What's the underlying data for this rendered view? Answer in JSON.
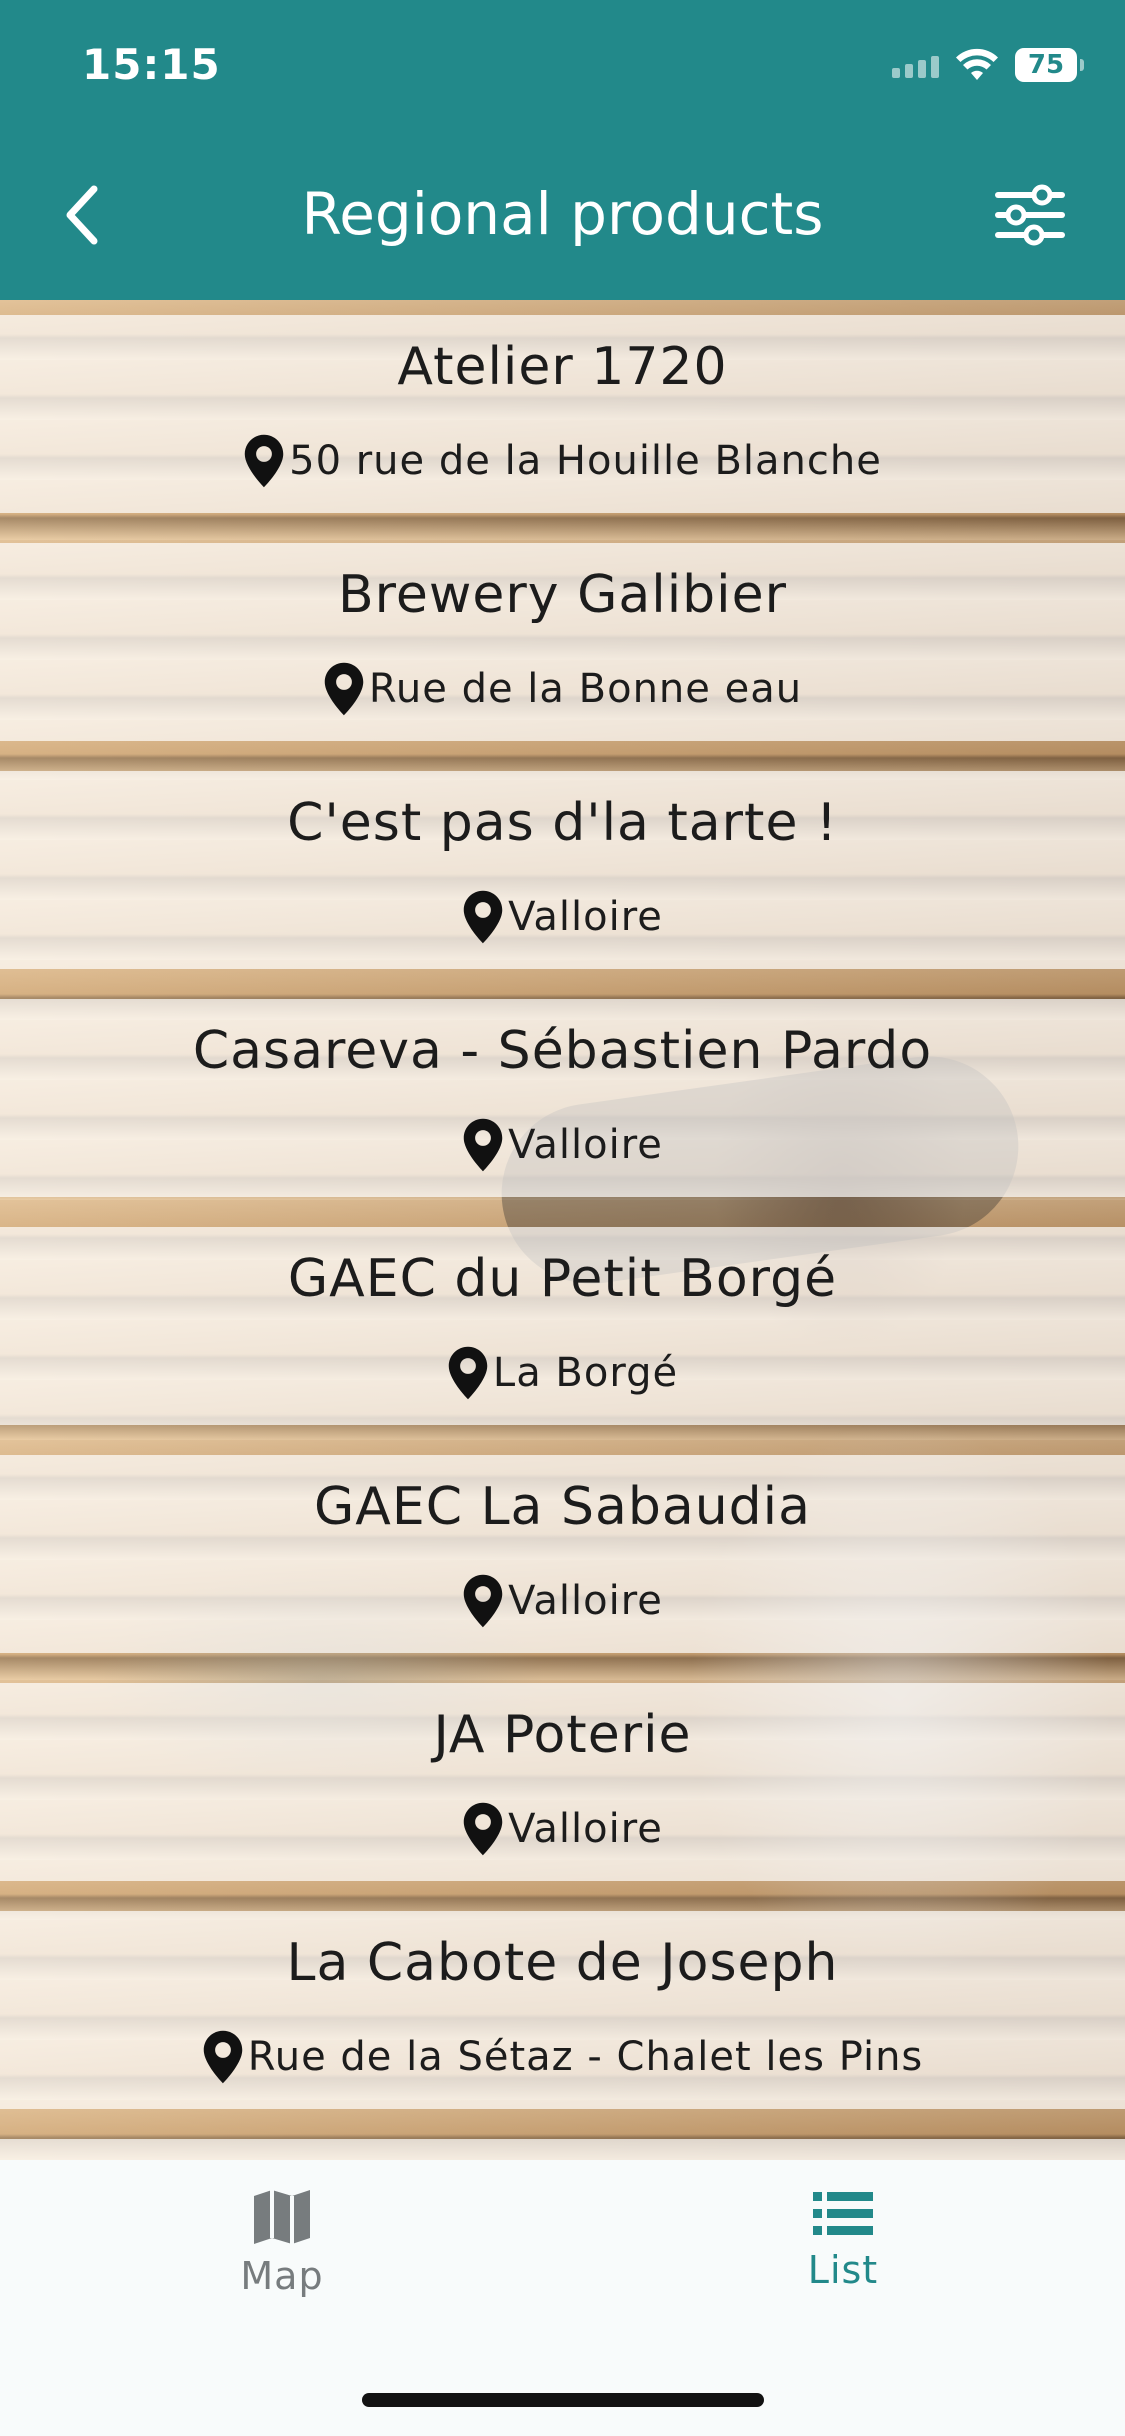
{
  "status_bar": {
    "time": "15:15",
    "battery": "75"
  },
  "header": {
    "title": "Regional products",
    "background_color": "#22898a"
  },
  "items": [
    {
      "name": "Atelier 1720",
      "address": "50 rue de la Houille Blanche"
    },
    {
      "name": "Brewery Galibier",
      "address": "Rue de la Bonne eau"
    },
    {
      "name": "C'est pas d'la tarte !",
      "address": "Valloire"
    },
    {
      "name": "Casareva - Sébastien Pardo",
      "address": "Valloire"
    },
    {
      "name": "GAEC du Petit Borgé",
      "address": "La Borgé"
    },
    {
      "name": "GAEC La Sabaudia",
      "address": "Valloire"
    },
    {
      "name": "JA Poterie",
      "address": "Valloire"
    },
    {
      "name": "La Cabote de Joseph",
      "address": "Rue de la Sétaz - Chalet les Pins"
    }
  ],
  "tabs": {
    "map": {
      "label": "Map",
      "icon": "map-icon"
    },
    "list": {
      "label": "List",
      "icon": "list-icon",
      "active_color": "#22898a"
    }
  }
}
